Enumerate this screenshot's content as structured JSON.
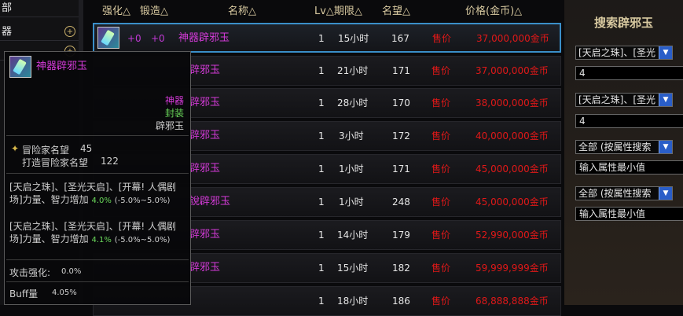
{
  "category_panel": {
    "items": [
      {
        "label": "部",
        "has_zoom": false
      },
      {
        "label": "器",
        "has_zoom": true
      },
      {
        "label": "",
        "has_zoom": true
      }
    ]
  },
  "table": {
    "headers": {
      "enhance": "强化△",
      "forge": "锻造△",
      "name": "名称△",
      "level_period": "Lv△期限△",
      "reputation": "名望△",
      "price": "价格(金币)△"
    },
    "rows": [
      {
        "enhance": "+0",
        "forge": "+0",
        "name": "神器辟邪玉",
        "lv": "1",
        "period": "15小时",
        "reputation": "167",
        "price_label": "售价",
        "price": "37,000,000金币",
        "selected": true
      },
      {
        "name": "辟邪玉",
        "lv": "1",
        "period": "21小时",
        "reputation": "171",
        "price_label": "售价",
        "price": "37,000,000金币"
      },
      {
        "name": "辟邪玉",
        "lv": "1",
        "period": "28小时",
        "reputation": "170",
        "price_label": "售价",
        "price": "38,000,000金币"
      },
      {
        "name": "辟邪玉",
        "lv": "1",
        "period": "3小时",
        "reputation": "172",
        "price_label": "售价",
        "price": "40,000,000金币"
      },
      {
        "name": "辟邪玉",
        "lv": "1",
        "period": "1小时",
        "reputation": "171",
        "price_label": "售价",
        "price": "45,000,000金币"
      },
      {
        "name": "說辟邪玉",
        "lv": "1",
        "period": "1小时",
        "reputation": "248",
        "price_label": "售价",
        "price": "45,000,000金币"
      },
      {
        "name": "辟邪玉",
        "lv": "1",
        "period": "14小时",
        "reputation": "179",
        "price_label": "售价",
        "price": "52,990,000金币"
      },
      {
        "name": "辟邪玉",
        "lv": "1",
        "period": "15小时",
        "reputation": "182",
        "price_label": "售价",
        "price": "59,999,999金币"
      },
      {
        "name": "",
        "lv": "1",
        "period": "18小时",
        "reputation": "186",
        "price_label": "售价",
        "price": "68,888,888金币"
      }
    ]
  },
  "search_panel": {
    "title": "搜索辟邪玉",
    "select1": "[天启之珠]、[圣光",
    "input1": "4",
    "select2": "[天启之珠]、[圣光",
    "input2": "4",
    "select3": "全部 (按属性搜索",
    "input3_placeholder": "输入属性最小值",
    "select4": "全部 (按属性搜索",
    "input4_placeholder": "输入属性最小值"
  },
  "tooltip": {
    "item_name": "神器辟邪玉",
    "rarity": "神器",
    "seal_status": "封装",
    "item_type": "辟邪玉",
    "adventurer_reputation_label": "冒险家名望",
    "adventurer_reputation": "45",
    "forge_reputation_label": "打造冒险家名望",
    "forge_reputation": "122",
    "effect1_text": "[天启之珠]、[圣光天启]、[开幕! 人偶剧场]力量、智力增加",
    "effect1_pct": "4.0%",
    "effect1_range": "(-5.0%~5.0%)",
    "effect2_text": "[天启之珠]、[圣光天启]、[开幕! 人偶剧场]力量、智力增加",
    "effect2_pct": "4.1%",
    "effect2_range": "(-5.0%~5.0%)",
    "attack_enhance_label": "攻击强化:",
    "attack_enhance_value": "0.0%",
    "buff_label": "Buff量",
    "buff_value": "4.05%"
  },
  "colors": {
    "selection_border": "#3a8fc9",
    "price_red": "#e01818",
    "epic_purple": "#d43ad8",
    "stat_green": "#6ad85a",
    "header_gold": "#d8c9a0"
  }
}
